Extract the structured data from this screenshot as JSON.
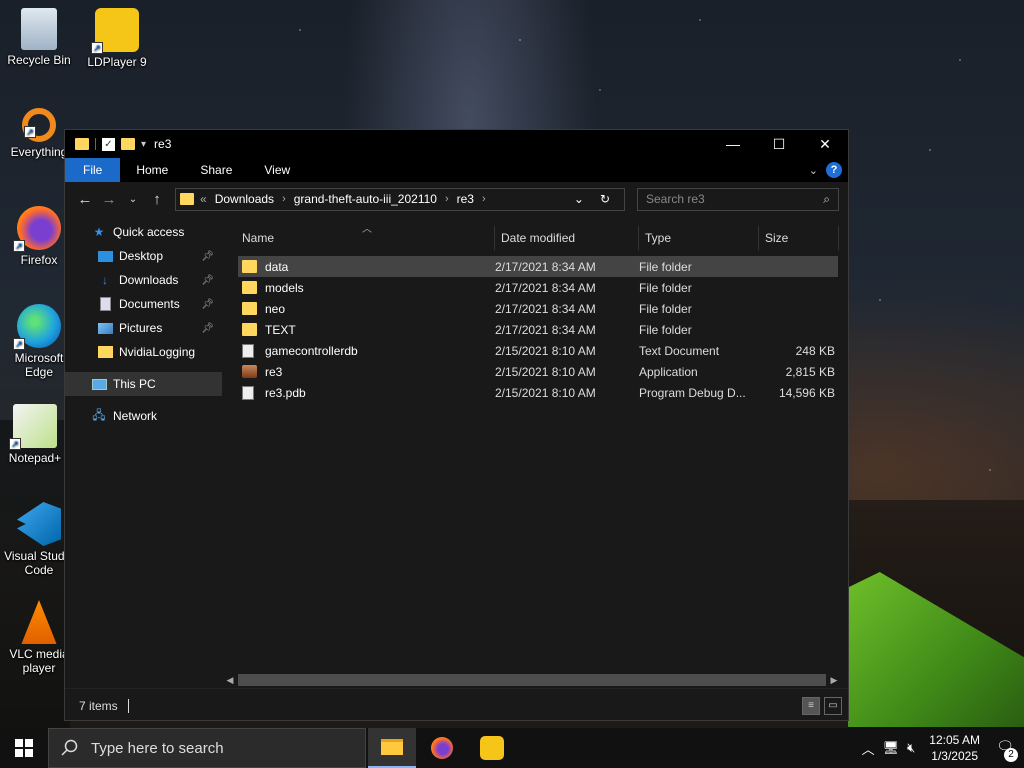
{
  "desktop": {
    "icons": [
      {
        "label": "Recycle Bin"
      },
      {
        "label": "LDPlayer 9"
      },
      {
        "label": "Everything"
      },
      {
        "label": "Firefox"
      },
      {
        "label": "Microsoft Edge"
      },
      {
        "label": "Notepad+"
      },
      {
        "label": "Visual Studio Code"
      },
      {
        "label": "VLC media player"
      }
    ]
  },
  "window": {
    "title": "re3",
    "ribbon": {
      "file": "File",
      "home": "Home",
      "share": "Share",
      "view": "View"
    },
    "address": {
      "prefix": "«",
      "crumbs": [
        "Downloads",
        "grand-theft-auto-iii_202110",
        "re3"
      ]
    },
    "search_placeholder": "Search re3",
    "sidebar": {
      "quick_access": "Quick access",
      "items": [
        "Desktop",
        "Downloads",
        "Documents",
        "Pictures",
        "NvidiaLogging"
      ],
      "this_pc": "This PC",
      "network": "Network"
    },
    "columns": {
      "name": "Name",
      "date": "Date modified",
      "type": "Type",
      "size": "Size"
    },
    "files": [
      {
        "name": "data",
        "date": "2/17/2021 8:34 AM",
        "type": "File folder",
        "size": "",
        "icon": "folder-icon"
      },
      {
        "name": "models",
        "date": "2/17/2021 8:34 AM",
        "type": "File folder",
        "size": "",
        "icon": "folder-icon"
      },
      {
        "name": "neo",
        "date": "2/17/2021 8:34 AM",
        "type": "File folder",
        "size": "",
        "icon": "folder-icon"
      },
      {
        "name": "TEXT",
        "date": "2/17/2021 8:34 AM",
        "type": "File folder",
        "size": "",
        "icon": "folder-icon"
      },
      {
        "name": "gamecontrollerdb",
        "date": "2/15/2021 8:10 AM",
        "type": "Text Document",
        "size": "248 KB",
        "icon": "text-file-icon"
      },
      {
        "name": "re3",
        "date": "2/15/2021 8:10 AM",
        "type": "Application",
        "size": "2,815 KB",
        "icon": "app-icon"
      },
      {
        "name": "re3.pdb",
        "date": "2/15/2021 8:10 AM",
        "type": "Program Debug D...",
        "size": "14,596 KB",
        "icon": "pdb-file-icon"
      }
    ],
    "status": "7 items"
  },
  "taskbar": {
    "search_placeholder": "Type here to search",
    "time": "12:05 AM",
    "date": "1/3/2025",
    "notification_count": "2"
  },
  "colors": {
    "accent": "#1b6ac9",
    "folder": "#ffd75e"
  }
}
